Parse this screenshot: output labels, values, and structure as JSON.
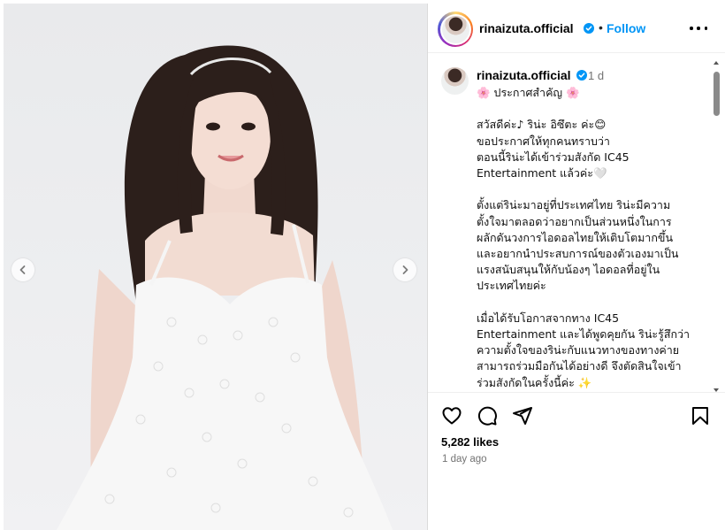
{
  "post": {
    "author": {
      "username": "rinaizuta.official",
      "verified": true,
      "follow_label": "Follow",
      "separator": "•"
    },
    "caption": {
      "username": "rinaizuta.official",
      "time": "1 d",
      "text": "🌸 ประกาศสำคัญ 🌸\n\nสวัสดีค่ะ♪ ริน่ะ อิซึตะ ค่ะ😊\nขอประกาศให้ทุกคนทราบว่า\nตอนนี้ริน่ะได้เข้าร่วมสังกัด IC45\nEntertainment แล้วค่ะ🤍\n\nตั้งแต่ริน่ะมาอยู่ที่ประเทศไทย ริน่ะมีความ\nตั้งใจมาตลอดว่าอยากเป็นส่วนหนึ่งในการ\nผลักดันวงการไอดอลไทยให้เติบโตมากขึ้น\nและอยากนำประสบการณ์ของตัวเองมาเป็น\nแรงสนับสนุนให้กับน้องๆ ไอดอลที่อยู่ใน\nประเทศไทยค่ะ\n\nเมื่อได้รับโอกาสจากทาง IC45\nEntertainment และได้พูดคุยกัน ริน่ะรู้สึกว่า\nความตั้งใจของริน่ะกับแนวทางของทางค่าย\nสามารถร่วมมือกันได้อย่างดี จึงตัดสินใจเข้า\nร่วมสังกัดในครั้งนี้ค่ะ ✨"
    },
    "likes": "5,282 likes",
    "posted_ago": "1 day ago"
  },
  "icons": {
    "header_more": "more-options-icon",
    "like": "heart-icon",
    "comment": "comment-icon",
    "share": "share-icon",
    "save": "bookmark-icon",
    "prev": "chevron-left-icon",
    "next": "chevron-right-icon",
    "verified": "verified-badge-icon"
  },
  "colors": {
    "follow_blue": "#0095f6",
    "verified_blue": "#0095f6",
    "muted_text": "#737373",
    "divider": "#dbdbdb"
  }
}
